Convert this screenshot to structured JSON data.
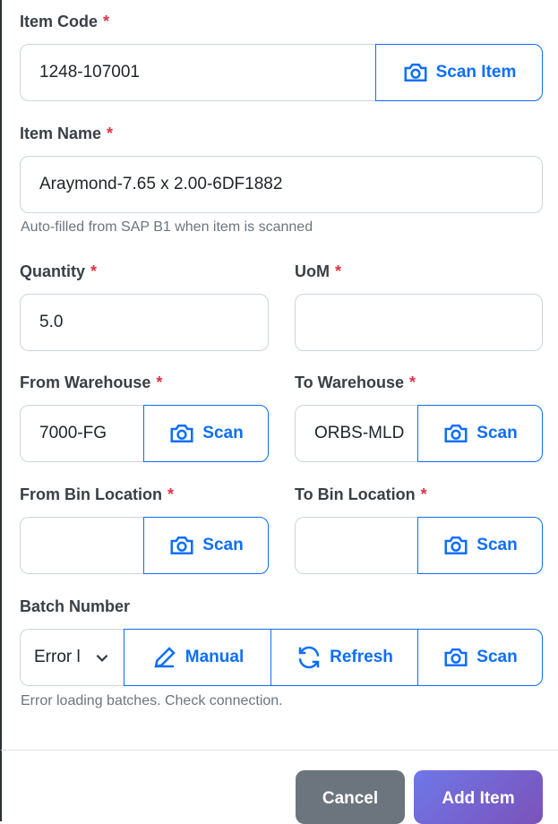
{
  "item_code": {
    "label": "Item Code",
    "required": "*",
    "value": "1248-107001",
    "scan_label": "Scan Item"
  },
  "item_name": {
    "label": "Item Name",
    "required": "*",
    "value": "Araymond-7.65 x 2.00-6DF1882",
    "help": "Auto-filled from SAP B1 when item is scanned"
  },
  "quantity": {
    "label": "Quantity",
    "required": "*",
    "value": "5.0"
  },
  "uom": {
    "label": "UoM",
    "required": "*",
    "value": ""
  },
  "from_warehouse": {
    "label": "From Warehouse",
    "required": "*",
    "value": "7000-FG",
    "scan_label": "Scan"
  },
  "to_warehouse": {
    "label": "To Warehouse",
    "required": "*",
    "value": "ORBS-MLD",
    "scan_label": "Scan"
  },
  "from_bin": {
    "label": "From Bin Location",
    "required": "*",
    "value": "",
    "scan_label": "Scan"
  },
  "to_bin": {
    "label": "To Bin Location",
    "required": "*",
    "value": "",
    "scan_label": "Scan"
  },
  "batch": {
    "label": "Batch Number",
    "selected": "Error l",
    "manual_label": "Manual",
    "refresh_label": "Refresh",
    "scan_label": "Scan",
    "help": "Error loading batches. Check connection."
  },
  "footer": {
    "cancel_label": "Cancel",
    "add_label": "Add Item"
  },
  "colors": {
    "primary": "#0d6efd",
    "required": "#dc3545",
    "cancel": "#6c757d",
    "add_start": "#6f77e8",
    "add_end": "#7b52b9"
  },
  "icons": {
    "scan": "camera-icon",
    "manual": "pencil-icon",
    "refresh": "refresh-icon",
    "dropdown": "chevron-down-icon"
  }
}
